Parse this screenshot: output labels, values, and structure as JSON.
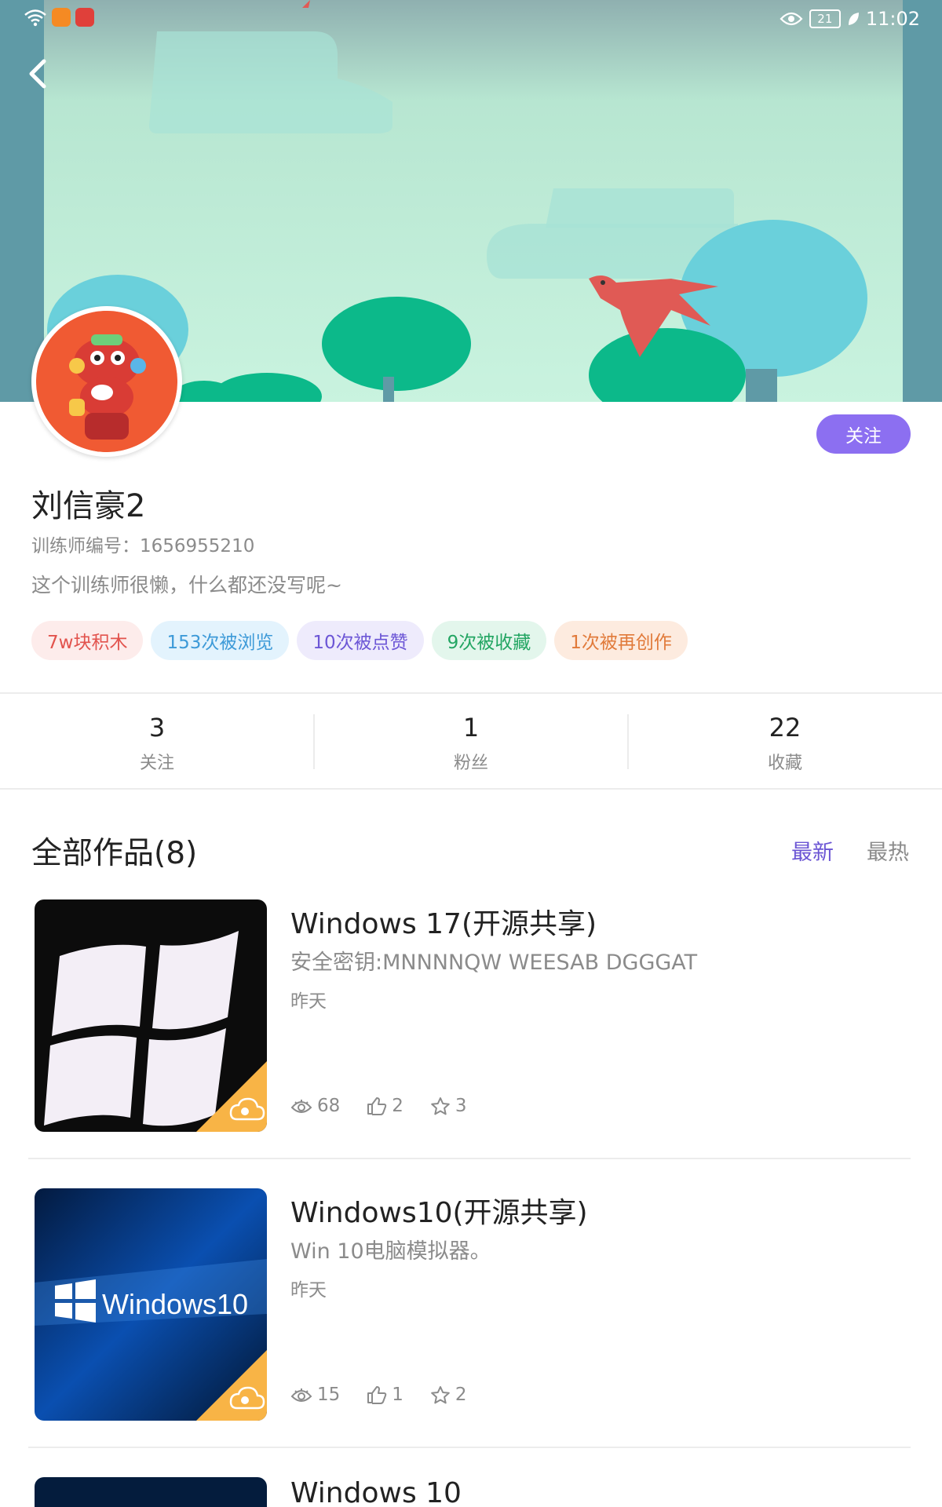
{
  "status_bar": {
    "time": "11:02",
    "battery": "21"
  },
  "profile": {
    "name": "刘信豪2",
    "trainer_id": "训练师编号：1656955210",
    "bio": "这个训练师很懒，什么都还没写呢~",
    "follow_label": "关注",
    "tags": [
      "7w块积木",
      "153次被浏览",
      "10次被点赞",
      "9次被收藏",
      "1次被再创作"
    ]
  },
  "stats": [
    {
      "value": "3",
      "label": "关注"
    },
    {
      "value": "1",
      "label": "粉丝"
    },
    {
      "value": "22",
      "label": "收藏"
    }
  ],
  "works": {
    "title": "全部作品(8)",
    "sort_newest": "最新",
    "sort_hottest": "最热",
    "items": [
      {
        "title": "Windows 17(开源共享)",
        "desc": "安全密钥:MNNNNQW WEESAB DGGGAT",
        "date": "昨天",
        "views": "68",
        "likes": "2",
        "favorites": "3"
      },
      {
        "title": "Windows10(开源共享)",
        "desc": "Win 10电脑模拟器。",
        "date": "昨天",
        "views": "15",
        "likes": "1",
        "favorites": "2",
        "thumb_text": "Windows10"
      },
      {
        "title": "Windows 10"
      }
    ]
  },
  "colors": {
    "accent": "#8c6ff1",
    "sort_active": "#6b55d4",
    "remix_badge": "#f8b446"
  }
}
